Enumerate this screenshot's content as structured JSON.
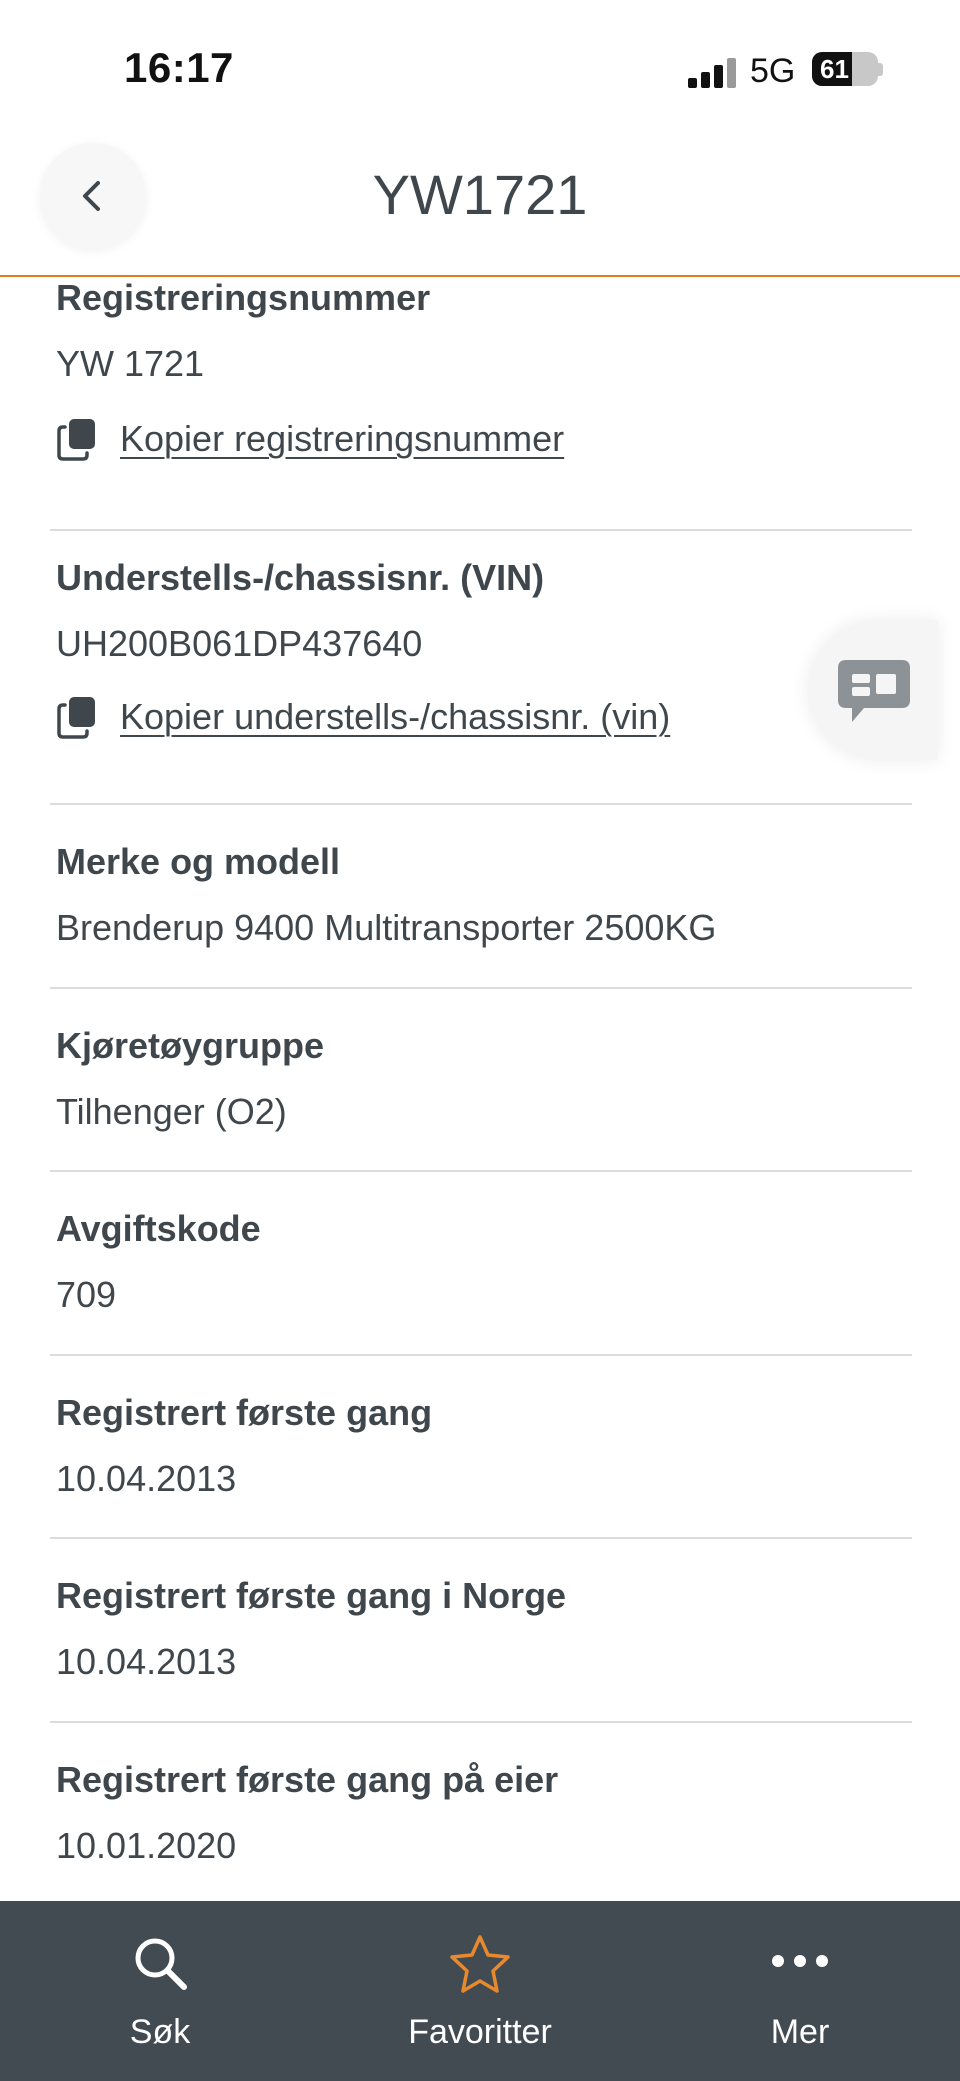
{
  "status_bar": {
    "time": "16:17",
    "network": "5G",
    "battery": "61",
    "battery_level": 0.61
  },
  "header": {
    "title": "YW1721",
    "back_icon": "chevron-left-icon"
  },
  "sections": [
    {
      "label": "Registreringsnummer",
      "value": "YW 1721",
      "copy_label": "Kopier registreringsnummer"
    },
    {
      "label": "Understells-/chassisnr. (VIN)",
      "value": "UH200B061DP437640",
      "copy_label": "Kopier understells-/chassisnr. (vin)"
    },
    {
      "label": "Merke og modell",
      "value": "Brenderup 9400 Multitransporter 2500KG"
    },
    {
      "label": "Kjøretøygruppe",
      "value": "Tilhenger (O2)"
    },
    {
      "label": "Avgiftskode",
      "value": "709"
    },
    {
      "label": "Registrert første gang",
      "value": "10.04.2013"
    },
    {
      "label": "Registrert første gang i Norge",
      "value": "10.04.2013"
    },
    {
      "label": "Registrert første gang på eier",
      "value": "10.01.2020"
    }
  ],
  "chat_button": {
    "icon": "chat-icon"
  },
  "bottom_nav": {
    "items": [
      {
        "label": "Søk",
        "icon": "search-icon"
      },
      {
        "label": "Favoritter",
        "icon": "star-icon"
      },
      {
        "label": "Mer",
        "icon": "more-icon"
      }
    ]
  },
  "colors": {
    "accent": "#e07b1f",
    "text": "#3f474d",
    "nav_background": "#434b52",
    "divider": "#dcdcdc"
  }
}
